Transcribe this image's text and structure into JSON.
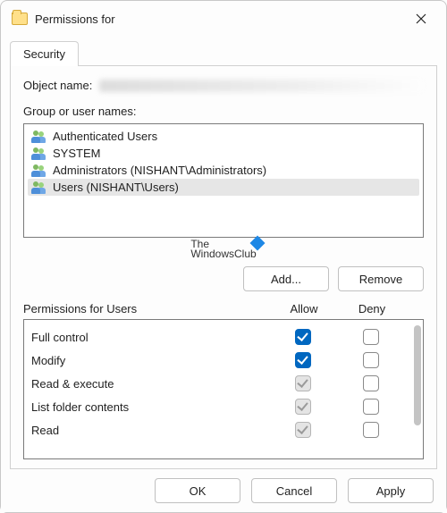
{
  "titlebar": {
    "prefix": "Permissions for",
    "object": ""
  },
  "tab": {
    "security": "Security"
  },
  "objectName": {
    "label": "Object name:",
    "value": ""
  },
  "groupsLabel": "Group or user names:",
  "groups": [
    {
      "label": "Authenticated Users",
      "selected": false
    },
    {
      "label": "SYSTEM",
      "selected": false
    },
    {
      "label": "Administrators (NISHANT\\Administrators)",
      "selected": false
    },
    {
      "label": "Users (NISHANT\\Users)",
      "selected": true
    }
  ],
  "watermark": {
    "text": "The\nWindowsClub"
  },
  "buttons": {
    "add": "Add...",
    "remove": "Remove",
    "ok": "OK",
    "cancel": "Cancel",
    "apply": "Apply"
  },
  "permHeader": {
    "title": "Permissions for Users",
    "allow": "Allow",
    "deny": "Deny"
  },
  "permissions": [
    {
      "label": "Full control",
      "allow": "checked",
      "deny": "empty"
    },
    {
      "label": "Modify",
      "allow": "checked",
      "deny": "empty"
    },
    {
      "label": "Read & execute",
      "allow": "grayed",
      "deny": "empty"
    },
    {
      "label": "List folder contents",
      "allow": "grayed",
      "deny": "empty"
    },
    {
      "label": "Read",
      "allow": "grayed",
      "deny": "empty"
    }
  ]
}
